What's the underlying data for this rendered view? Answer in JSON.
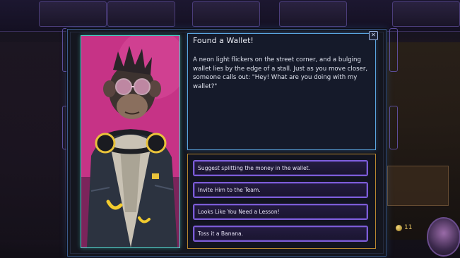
{
  "event": {
    "title": "Found a Wallet!",
    "description": "A neon light flickers on the street corner, and a bulging wallet lies by the edge of a stall. Just as you move closer, someone calls out: \"Hey! What are you doing with my wallet?\"",
    "close_icon": "close-icon"
  },
  "choices": [
    {
      "label": "Suggest splitting the money in the wallet."
    },
    {
      "label": "Invite Him to the Team."
    },
    {
      "label": "Looks Like You Need a Lesson!"
    },
    {
      "label": "Toss it a Banana."
    }
  ],
  "hud": {
    "coins": "11"
  },
  "colors": {
    "portrait_border": "#4ed0c8",
    "story_border": "#5aa6e0",
    "choices_border": "#b7862f",
    "choice_border": "#7c5cd6",
    "portrait_bg": "#d43a8f"
  }
}
